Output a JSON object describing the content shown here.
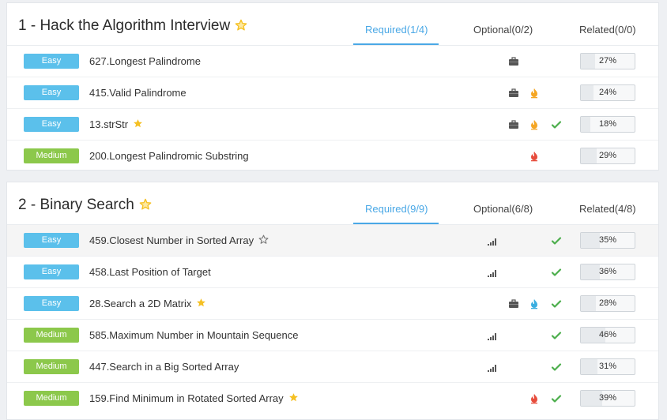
{
  "colors": {
    "accent": "#4aa8e6",
    "easy": "#5bc0eb",
    "medium": "#8cc84b",
    "star": "#f5c023",
    "check": "#4cae4c"
  },
  "sections": [
    {
      "title": "1 - Hack the Algorithm Interview",
      "tabs": {
        "required": "Required(1/4)",
        "optional": "Optional(0/2)",
        "related": "Related(0/0)"
      },
      "problems": [
        {
          "difficulty": "Easy",
          "name": "627.Longest Palindrome",
          "progress": "27%",
          "icons": [
            "briefcase-icon"
          ]
        },
        {
          "difficulty": "Easy",
          "name": "415.Valid Palindrome",
          "progress": "24%",
          "icons": [
            "briefcase-icon",
            "flame-orange-icon"
          ]
        },
        {
          "difficulty": "Easy",
          "name": "13.strStr",
          "starred": true,
          "progress": "18%",
          "icons": [
            "briefcase-icon",
            "flame-orange-icon",
            "check-icon"
          ]
        },
        {
          "difficulty": "Medium",
          "name": "200.Longest Palindromic Substring",
          "progress": "29%",
          "icons": [
            "flame-red-icon"
          ]
        }
      ]
    },
    {
      "title": "2 - Binary Search",
      "tabs": {
        "required": "Required(9/9)",
        "optional": "Optional(6/8)",
        "related": "Related(4/8)"
      },
      "problems": [
        {
          "difficulty": "Easy",
          "name": "459.Closest Number in Sorted Array",
          "outline_star": true,
          "progress": "35%",
          "icons": [
            "signal-icon",
            "check-icon"
          ]
        },
        {
          "difficulty": "Easy",
          "name": "458.Last Position of Target",
          "progress": "36%",
          "icons": [
            "signal-icon",
            "check-icon"
          ]
        },
        {
          "difficulty": "Easy",
          "name": "28.Search a 2D Matrix",
          "starred": true,
          "progress": "28%",
          "icons": [
            "briefcase-icon",
            "flame-blue-icon",
            "check-icon"
          ]
        },
        {
          "difficulty": "Medium",
          "name": "585.Maximum Number in Mountain Sequence",
          "progress": "46%",
          "icons": [
            "signal-icon",
            "check-icon"
          ]
        },
        {
          "difficulty": "Medium",
          "name": "447.Search in a Big Sorted Array",
          "progress": "31%",
          "icons": [
            "signal-icon",
            "check-icon"
          ]
        },
        {
          "difficulty": "Medium",
          "name": "159.Find Minimum in Rotated Sorted Array",
          "starred": true,
          "progress": "39%",
          "icons": [
            "flame-red-icon",
            "check-icon"
          ]
        }
      ]
    }
  ]
}
